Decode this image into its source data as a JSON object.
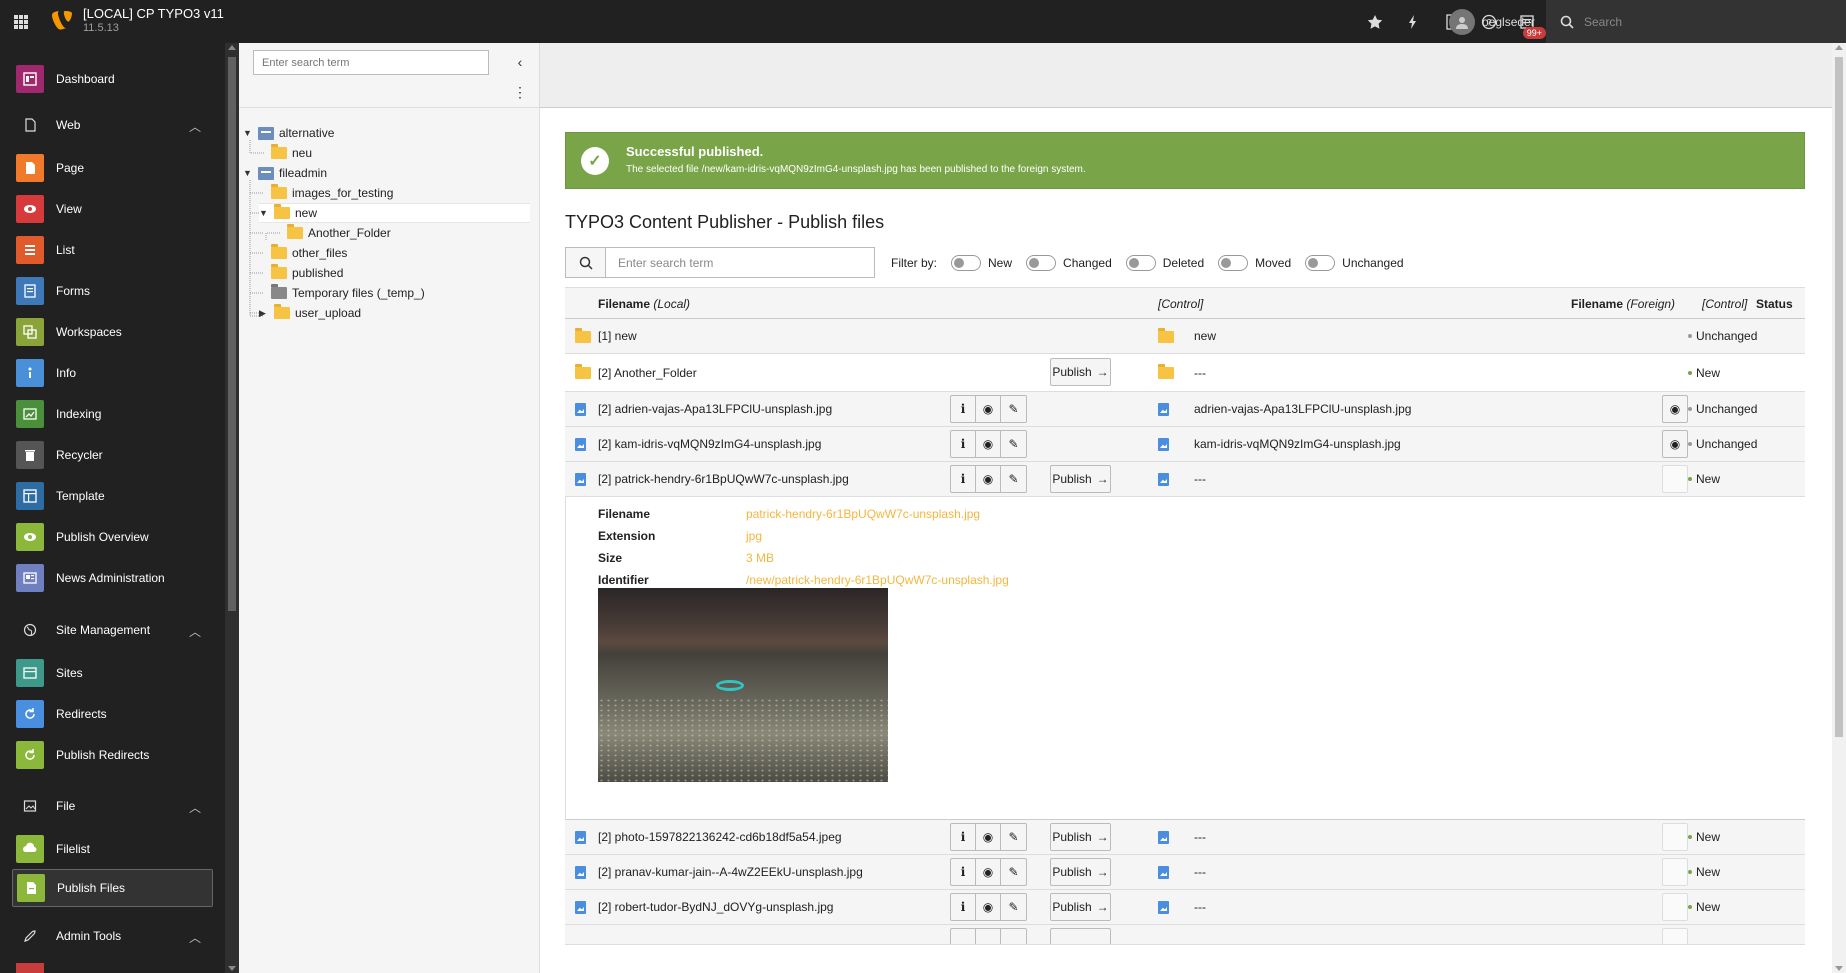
{
  "topbar": {
    "site_title": "[LOCAL] CP TYPO3 v11",
    "site_version": "11.5.13",
    "badge": "99+",
    "username": "oeglseder",
    "search_placeholder": "Search"
  },
  "modules": {
    "dashboard": "Dashboard",
    "web": "Web",
    "page": "Page",
    "view": "View",
    "list": "List",
    "forms": "Forms",
    "workspaces": "Workspaces",
    "info": "Info",
    "indexing": "Indexing",
    "recycler": "Recycler",
    "template": "Template",
    "publish_overview": "Publish Overview",
    "news_administration": "News Administration",
    "site_management": "Site Management",
    "sites": "Sites",
    "redirects": "Redirects",
    "publish_redirects": "Publish Redirects",
    "file": "File",
    "filelist": "Filelist",
    "publish_files": "Publish Files",
    "admin_tools": "Admin Tools"
  },
  "tree": {
    "search_placeholder": "Enter search term",
    "nodes": {
      "alternative": "alternative",
      "neu": "neu",
      "fileadmin": "fileadmin",
      "images_for_testing": "images_for_testing",
      "new": "new",
      "another_folder": "Another_Folder",
      "other_files": "other_files",
      "published": "published",
      "temp": "Temporary files (_temp_)",
      "user_upload": "user_upload"
    }
  },
  "alert": {
    "title": "Successful published.",
    "message": "The selected file /new/kam-idris-vqMQN9zImG4-unsplash.jpg has been published to the foreign system."
  },
  "page_title": "TYPO3 Content Publisher - Publish files",
  "search_placeholder": "Enter search term",
  "filter": {
    "label": "Filter by:",
    "new": "New",
    "changed": "Changed",
    "deleted": "Deleted",
    "moved": "Moved",
    "unchanged": "Unchanged"
  },
  "table": {
    "headers": {
      "filename": "Filename",
      "local": "(Local)",
      "control": "[Control]",
      "foreign": "(Foreign)",
      "control2": "[Control]",
      "status": "Status"
    },
    "rows": [
      {
        "local": "[1] new",
        "foreign": "new",
        "status": "Unchanged"
      },
      {
        "local": "[2] Another_Folder",
        "foreign": "---",
        "status": "New"
      },
      {
        "local": "[2] adrien-vajas-Apa13LFPClU-unsplash.jpg",
        "foreign": "adrien-vajas-Apa13LFPClU-unsplash.jpg",
        "status": "Unchanged"
      },
      {
        "local": "[2] kam-idris-vqMQN9zImG4-unsplash.jpg",
        "foreign": "kam-idris-vqMQN9zImG4-unsplash.jpg",
        "status": "Unchanged"
      },
      {
        "local": "[2] patrick-hendry-6r1BpUQwW7c-unsplash.jpg",
        "foreign": "---",
        "status": "New"
      },
      {
        "local": "[2] photo-1597822136242-cd6b18df5a54.jpeg",
        "foreign": "---",
        "status": "New"
      },
      {
        "local": "[2] pranav-kumar-jain--A-4wZ2EEkU-unsplash.jpg",
        "foreign": "---",
        "status": "New"
      },
      {
        "local": "[2] robert-tudor-BydNJ_dOVYg-unsplash.jpg",
        "foreign": "---",
        "status": "New"
      }
    ],
    "publish_label": "Publish",
    "details": {
      "filename_label": "Filename",
      "filename_value": "patrick-hendry-6r1BpUQwW7c-unsplash.jpg",
      "extension_label": "Extension",
      "extension_value": "jpg",
      "size_label": "Size",
      "size_value": "3 MB",
      "identifier_label": "Identifier",
      "identifier_value": "/new/patrick-hendry-6r1BpUQwW7c-unsplash.jpg"
    }
  },
  "colors": {
    "new_dot": "#79a548",
    "unchanged_dot": "#999999",
    "alert_bg": "#79a548"
  }
}
